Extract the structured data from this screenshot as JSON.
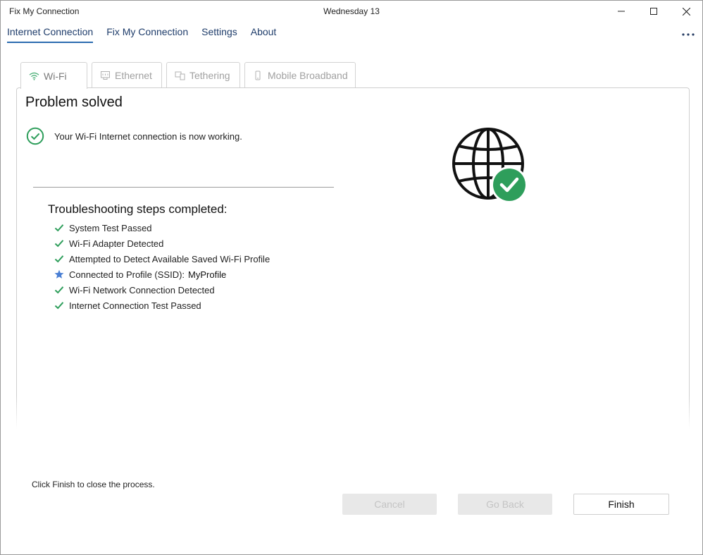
{
  "window": {
    "app_title": "Fix My Connection",
    "date_title": "Wednesday 13"
  },
  "nav": {
    "items": [
      {
        "label": "Internet Connection",
        "active": true
      },
      {
        "label": "Fix My Connection",
        "active": false
      },
      {
        "label": "Settings",
        "active": false
      },
      {
        "label": "About",
        "active": false
      }
    ],
    "more_icon": "more-horizontal-icon"
  },
  "tabs": [
    {
      "label": "Wi-Fi",
      "icon": "wifi-icon",
      "active": true
    },
    {
      "label": "Ethernet",
      "icon": "ethernet-icon",
      "active": false
    },
    {
      "label": "Tethering",
      "icon": "tethering-icon",
      "active": false
    },
    {
      "label": "Mobile Broadband",
      "icon": "mobile-broadband-icon",
      "active": false
    }
  ],
  "result": {
    "title": "Problem solved",
    "status_message": "Your Wi-Fi Internet connection is now working.",
    "status_icon": "check-circle-icon"
  },
  "steps": {
    "heading": "Troubleshooting steps completed:",
    "items": [
      {
        "label": "System Test Passed",
        "icon": "check-icon"
      },
      {
        "label": "Wi-Fi Adapter Detected",
        "icon": "check-icon"
      },
      {
        "label": "Attempted to Detect Available Saved Wi-Fi Profile",
        "icon": "check-icon"
      },
      {
        "label": "Connected to Profile (SSID):",
        "icon": "star-icon",
        "value": "MyProfile"
      },
      {
        "label": "Wi-Fi Network Connection Detected",
        "icon": "check-icon"
      },
      {
        "label": "Internet Connection Test Passed",
        "icon": "check-icon"
      }
    ]
  },
  "footer": {
    "note": "Click Finish to close the process.",
    "cancel_label": "Cancel",
    "back_label": "Go Back",
    "finish_label": "Finish"
  },
  "colors": {
    "accent": "#2b6cb0",
    "success": "#2e9e5b",
    "star": "#4a7fd4",
    "nav_text": "#1f3d6b"
  }
}
